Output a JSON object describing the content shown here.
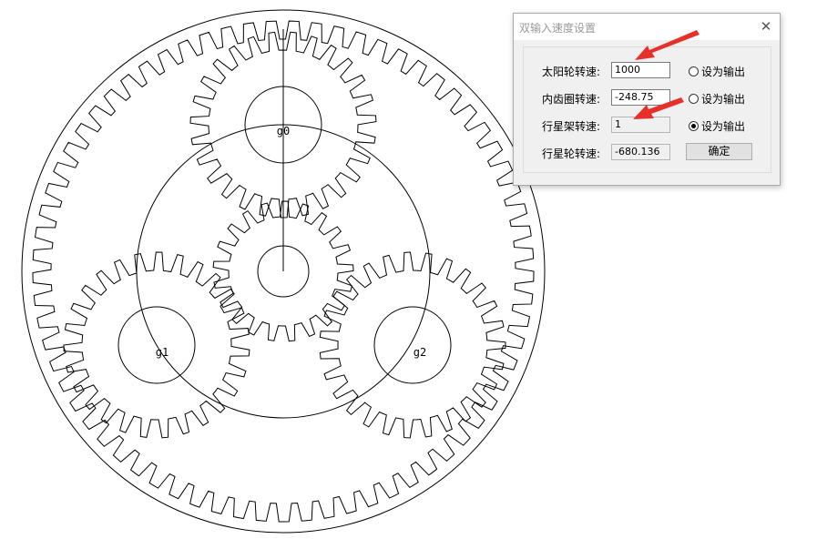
{
  "drawing": {
    "gear_labels": {
      "g0": "g0",
      "g1": "g1",
      "g2": "g2"
    }
  },
  "dialog": {
    "title": "双输入速度设置",
    "close_glyph": "✕",
    "rows": [
      {
        "label": "太阳轮转速:",
        "value": "1000",
        "radio_label": "设为输出",
        "checked": false
      },
      {
        "label": "内齿圈转速:",
        "value": "-248.75",
        "radio_label": "设为输出",
        "checked": false
      },
      {
        "label": "行星架转速:",
        "value": "1",
        "radio_label": "设为输出",
        "checked": true
      },
      {
        "label": "行星轮转速:",
        "value": "-680.136"
      }
    ],
    "ok_label": "确定"
  },
  "colors": {
    "line": "#000000",
    "arrow": "#e8302a"
  }
}
